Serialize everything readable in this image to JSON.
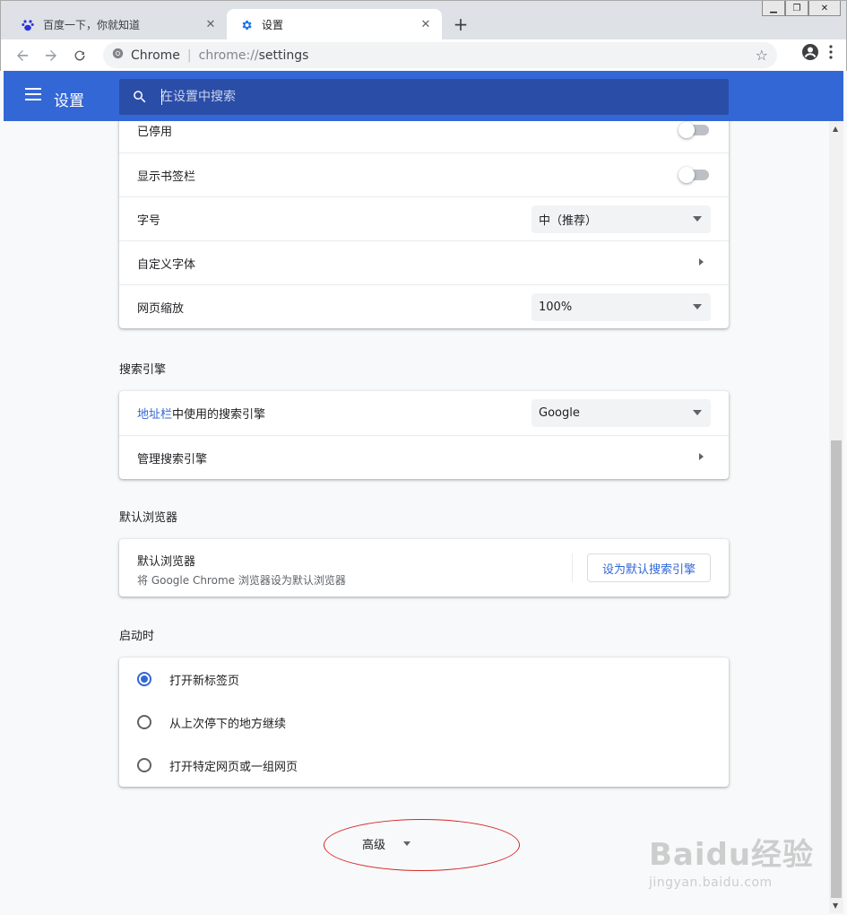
{
  "browser": {
    "tabs": [
      {
        "title": "百度一下，你就知道",
        "icon": "baidu-paw-icon",
        "active": false
      },
      {
        "title": "设置",
        "icon": "gear-icon",
        "active": true
      }
    ],
    "omnibox": {
      "site": "Chrome",
      "url_host": "chrome://",
      "url_path": "settings"
    },
    "new_tab": "+"
  },
  "header": {
    "title": "设置",
    "search_placeholder": "在设置中搜索"
  },
  "appearance": {
    "rows": [
      {
        "label": "已停用",
        "control": "toggle",
        "on": false
      },
      {
        "label": "显示书签栏",
        "control": "toggle",
        "on": false
      },
      {
        "label": "字号",
        "control": "select",
        "value": "中（推荐）"
      },
      {
        "label": "自定义字体",
        "control": "subpage"
      },
      {
        "label": "网页缩放",
        "control": "select",
        "value": "100%"
      }
    ]
  },
  "search_engine": {
    "title": "搜索引擎",
    "row1_link": "地址栏",
    "row1_rest": "中使用的搜索引擎",
    "row1_value": "Google",
    "row2": "管理搜索引擎"
  },
  "default_browser": {
    "title": "默认浏览器",
    "primary": "默认浏览器",
    "secondary": "将 Google Chrome 浏览器设为默认浏览器",
    "button": "设为默认搜索引擎"
  },
  "on_startup": {
    "title": "启动时",
    "options": [
      {
        "label": "打开新标签页",
        "checked": true
      },
      {
        "label": "从上次停下的地方继续",
        "checked": false
      },
      {
        "label": "打开特定网页或一组网页",
        "checked": false
      }
    ]
  },
  "advanced": "高级",
  "watermark": {
    "brand": "Baidu经验",
    "url": "jingyan.baidu.com"
  },
  "colors": {
    "accent": "#3367d6",
    "header": "#3367d6",
    "annotation": "#d9262a"
  }
}
